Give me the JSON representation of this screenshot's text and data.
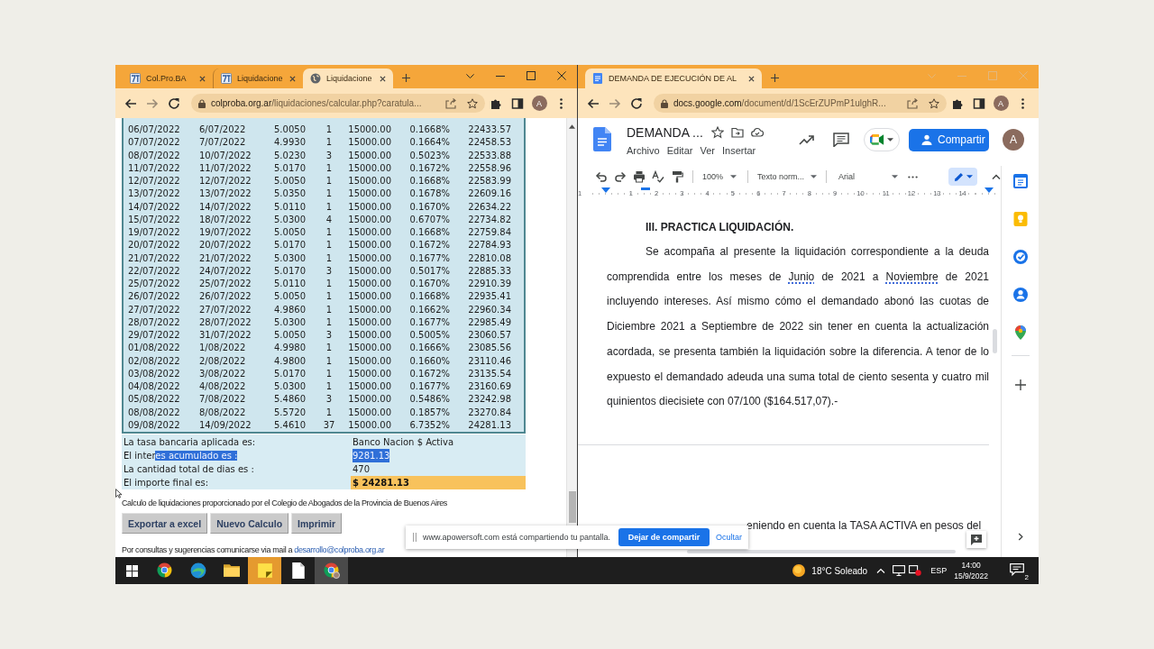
{
  "windows": [
    {
      "kind": "calculator",
      "focused": true,
      "tabs": [
        {
          "kind": "logo",
          "title": "Col.Pro.BA",
          "selected": false
        },
        {
          "kind": "logo",
          "title": "Liquidacione",
          "selected": false
        },
        {
          "kind": "globe",
          "title": "Liquidacione",
          "selected": true
        }
      ],
      "url": {
        "host": "colproba.org.ar",
        "rest": "/liquidaciones/calcular.php?caratula..."
      },
      "avatar": "A",
      "table": {
        "rows": [
          [
            "06/07/2022",
            "6/07/2022",
            "5.0050",
            "1",
            "15000.00",
            "0.1668%",
            "22433.57"
          ],
          [
            "07/07/2022",
            "7/07/2022",
            "4.9930",
            "1",
            "15000.00",
            "0.1664%",
            "22458.53"
          ],
          [
            "08/07/2022",
            "10/07/2022",
            "5.0230",
            "3",
            "15000.00",
            "0.5023%",
            "22533.88"
          ],
          [
            "11/07/2022",
            "11/07/2022",
            "5.0170",
            "1",
            "15000.00",
            "0.1672%",
            "22558.96"
          ],
          [
            "12/07/2022",
            "12/07/2022",
            "5.0050",
            "1",
            "15000.00",
            "0.1668%",
            "22583.99"
          ],
          [
            "13/07/2022",
            "13/07/2022",
            "5.0350",
            "1",
            "15000.00",
            "0.1678%",
            "22609.16"
          ],
          [
            "14/07/2022",
            "14/07/2022",
            "5.0110",
            "1",
            "15000.00",
            "0.1670%",
            "22634.22"
          ],
          [
            "15/07/2022",
            "18/07/2022",
            "5.0300",
            "4",
            "15000.00",
            "0.6707%",
            "22734.82"
          ],
          [
            "19/07/2022",
            "19/07/2022",
            "5.0050",
            "1",
            "15000.00",
            "0.1668%",
            "22759.84"
          ],
          [
            "20/07/2022",
            "20/07/2022",
            "5.0170",
            "1",
            "15000.00",
            "0.1672%",
            "22784.93"
          ],
          [
            "21/07/2022",
            "21/07/2022",
            "5.0300",
            "1",
            "15000.00",
            "0.1677%",
            "22810.08"
          ],
          [
            "22/07/2022",
            "24/07/2022",
            "5.0170",
            "3",
            "15000.00",
            "0.5017%",
            "22885.33"
          ],
          [
            "25/07/2022",
            "25/07/2022",
            "5.0110",
            "1",
            "15000.00",
            "0.1670%",
            "22910.39"
          ],
          [
            "26/07/2022",
            "26/07/2022",
            "5.0050",
            "1",
            "15000.00",
            "0.1668%",
            "22935.41"
          ],
          [
            "27/07/2022",
            "27/07/2022",
            "4.9860",
            "1",
            "15000.00",
            "0.1662%",
            "22960.34"
          ],
          [
            "28/07/2022",
            "28/07/2022",
            "5.0300",
            "1",
            "15000.00",
            "0.1677%",
            "22985.49"
          ],
          [
            "29/07/2022",
            "31/07/2022",
            "5.0050",
            "3",
            "15000.00",
            "0.5005%",
            "23060.57"
          ],
          [
            "01/08/2022",
            "1/08/2022",
            "4.9980",
            "1",
            "15000.00",
            "0.1666%",
            "23085.56"
          ],
          [
            "02/08/2022",
            "2/08/2022",
            "4.9800",
            "1",
            "15000.00",
            "0.1660%",
            "23110.46"
          ],
          [
            "03/08/2022",
            "3/08/2022",
            "5.0170",
            "1",
            "15000.00",
            "0.1672%",
            "23135.54"
          ],
          [
            "04/08/2022",
            "4/08/2022",
            "5.0300",
            "1",
            "15000.00",
            "0.1677%",
            "23160.69"
          ],
          [
            "05/08/2022",
            "7/08/2022",
            "5.4860",
            "3",
            "15000.00",
            "0.5486%",
            "23242.98"
          ],
          [
            "08/08/2022",
            "8/08/2022",
            "5.5720",
            "1",
            "15000.00",
            "0.1857%",
            "23270.84"
          ],
          [
            "09/08/2022",
            "14/09/2022",
            "5.4610",
            "37",
            "15000.00",
            "6.7352%",
            "24281.13"
          ]
        ]
      },
      "summary": [
        {
          "kind": "plain",
          "label": "La tasa bancaria aplicada es:",
          "value": "Banco Nacion $ Activa",
          "value_highlighted": false
        },
        {
          "kind": "plain",
          "label": "El inter",
          "label_highlighted": "es acumulado es :",
          "value": "9281.13",
          "value_highlighted": true
        },
        {
          "kind": "plain",
          "label": "La cantidad total de dias es :",
          "value": "470",
          "value_highlighted": false
        },
        {
          "kind": "total",
          "label": "El importe final es:",
          "value": "$ 24281.13",
          "value_highlighted": false
        }
      ],
      "credit": "Calculo de liquidaciones proporcionado por el Colegio de Abogados de la Provincia de Buenos Aires",
      "buttons": [
        "Exportar a excel",
        "Nuevo Calculo",
        "Imprimir"
      ],
      "contact": {
        "text": "Por consultas y sugerencias comunicarse via mail a",
        "link": "desarrollo@colproba.org.ar"
      }
    },
    {
      "kind": "document",
      "focused": false,
      "tabs": [
        {
          "kind": "docs",
          "title": "DEMANDA DE EJECUCIÓN DE AL",
          "selected": true
        }
      ],
      "url": {
        "host": "docs.google.com",
        "rest": "/document/d/1ScErZUPmP1ulghR..."
      },
      "avatar": "A",
      "doc": {
        "title": "DEMANDA ...",
        "menu": [
          "Archivo",
          "Editar",
          "Ver",
          "Insertar"
        ],
        "share_button": "Compartir",
        "account": "A",
        "zoom": "100%",
        "style": "Texto norm...",
        "font": "Arial",
        "ruler": [
          "1",
          "1",
          "2",
          "3",
          "4",
          "5",
          "6",
          "7",
          "8",
          "9",
          "10",
          "11",
          "12",
          "13",
          "14"
        ],
        "heading": "III. PRACTICA LIQUIDACIÓN.",
        "paragraph": [
          [
            {
              "text": "Se acompaña al presente la liquidación correspondiente a la deuda",
              "flagged": false
            }
          ],
          [
            {
              "text": "comprendida entre los meses de ",
              "flagged": false
            },
            {
              "text": "Junio",
              "flagged": true
            },
            {
              "text": " de 2021 a ",
              "flagged": false
            },
            {
              "text": "Noviembre",
              "flagged": true
            },
            {
              "text": " de 2021",
              "flagged": false
            }
          ],
          [
            {
              "text": "incluyendo intereses. Así mismo cómo el demandado abonó las cuotas de",
              "flagged": false
            }
          ],
          [
            {
              "text": "Diciembre 2021 a Septiembre de 2022 sin tener en cuenta la actualización",
              "flagged": false
            }
          ],
          [
            {
              "text": "acordada, se presenta también la liquidación sobre la diferencia. A tenor de lo",
              "flagged": false
            }
          ],
          [
            {
              "text": "expuesto el demandado adeuda una suma total de ciento sesenta y cuatro mil",
              "flagged": false
            }
          ],
          [
            {
              "text": "quinientos diecisiete con 07/100 ($164.517,07).-",
              "flagged": false
            }
          ]
        ],
        "next_page_text": "eniendo en cuenta la TASA ACTIVA en pesos del"
      }
    }
  ],
  "share_notice": {
    "message": "www.apowersoft.com está compartiendo tu pantalla.",
    "stop_button": "Dejar de compartir",
    "hide_link": "Ocultar"
  },
  "taskbar": {
    "apps": [
      {
        "kind": "chrome",
        "active": false,
        "flashing": false
      },
      {
        "kind": "edge",
        "active": false,
        "flashing": false
      },
      {
        "kind": "explorer",
        "active": false,
        "flashing": false
      },
      {
        "kind": "notes",
        "active": false,
        "flashing": true
      },
      {
        "kind": "file",
        "active": false,
        "flashing": false
      },
      {
        "kind": "chromeprofile",
        "active": true,
        "flashing": false
      }
    ],
    "weather": "18°C Soleado",
    "language": "ESP",
    "time": "14:00",
    "date": "15/9/2022",
    "notifications": "2"
  }
}
